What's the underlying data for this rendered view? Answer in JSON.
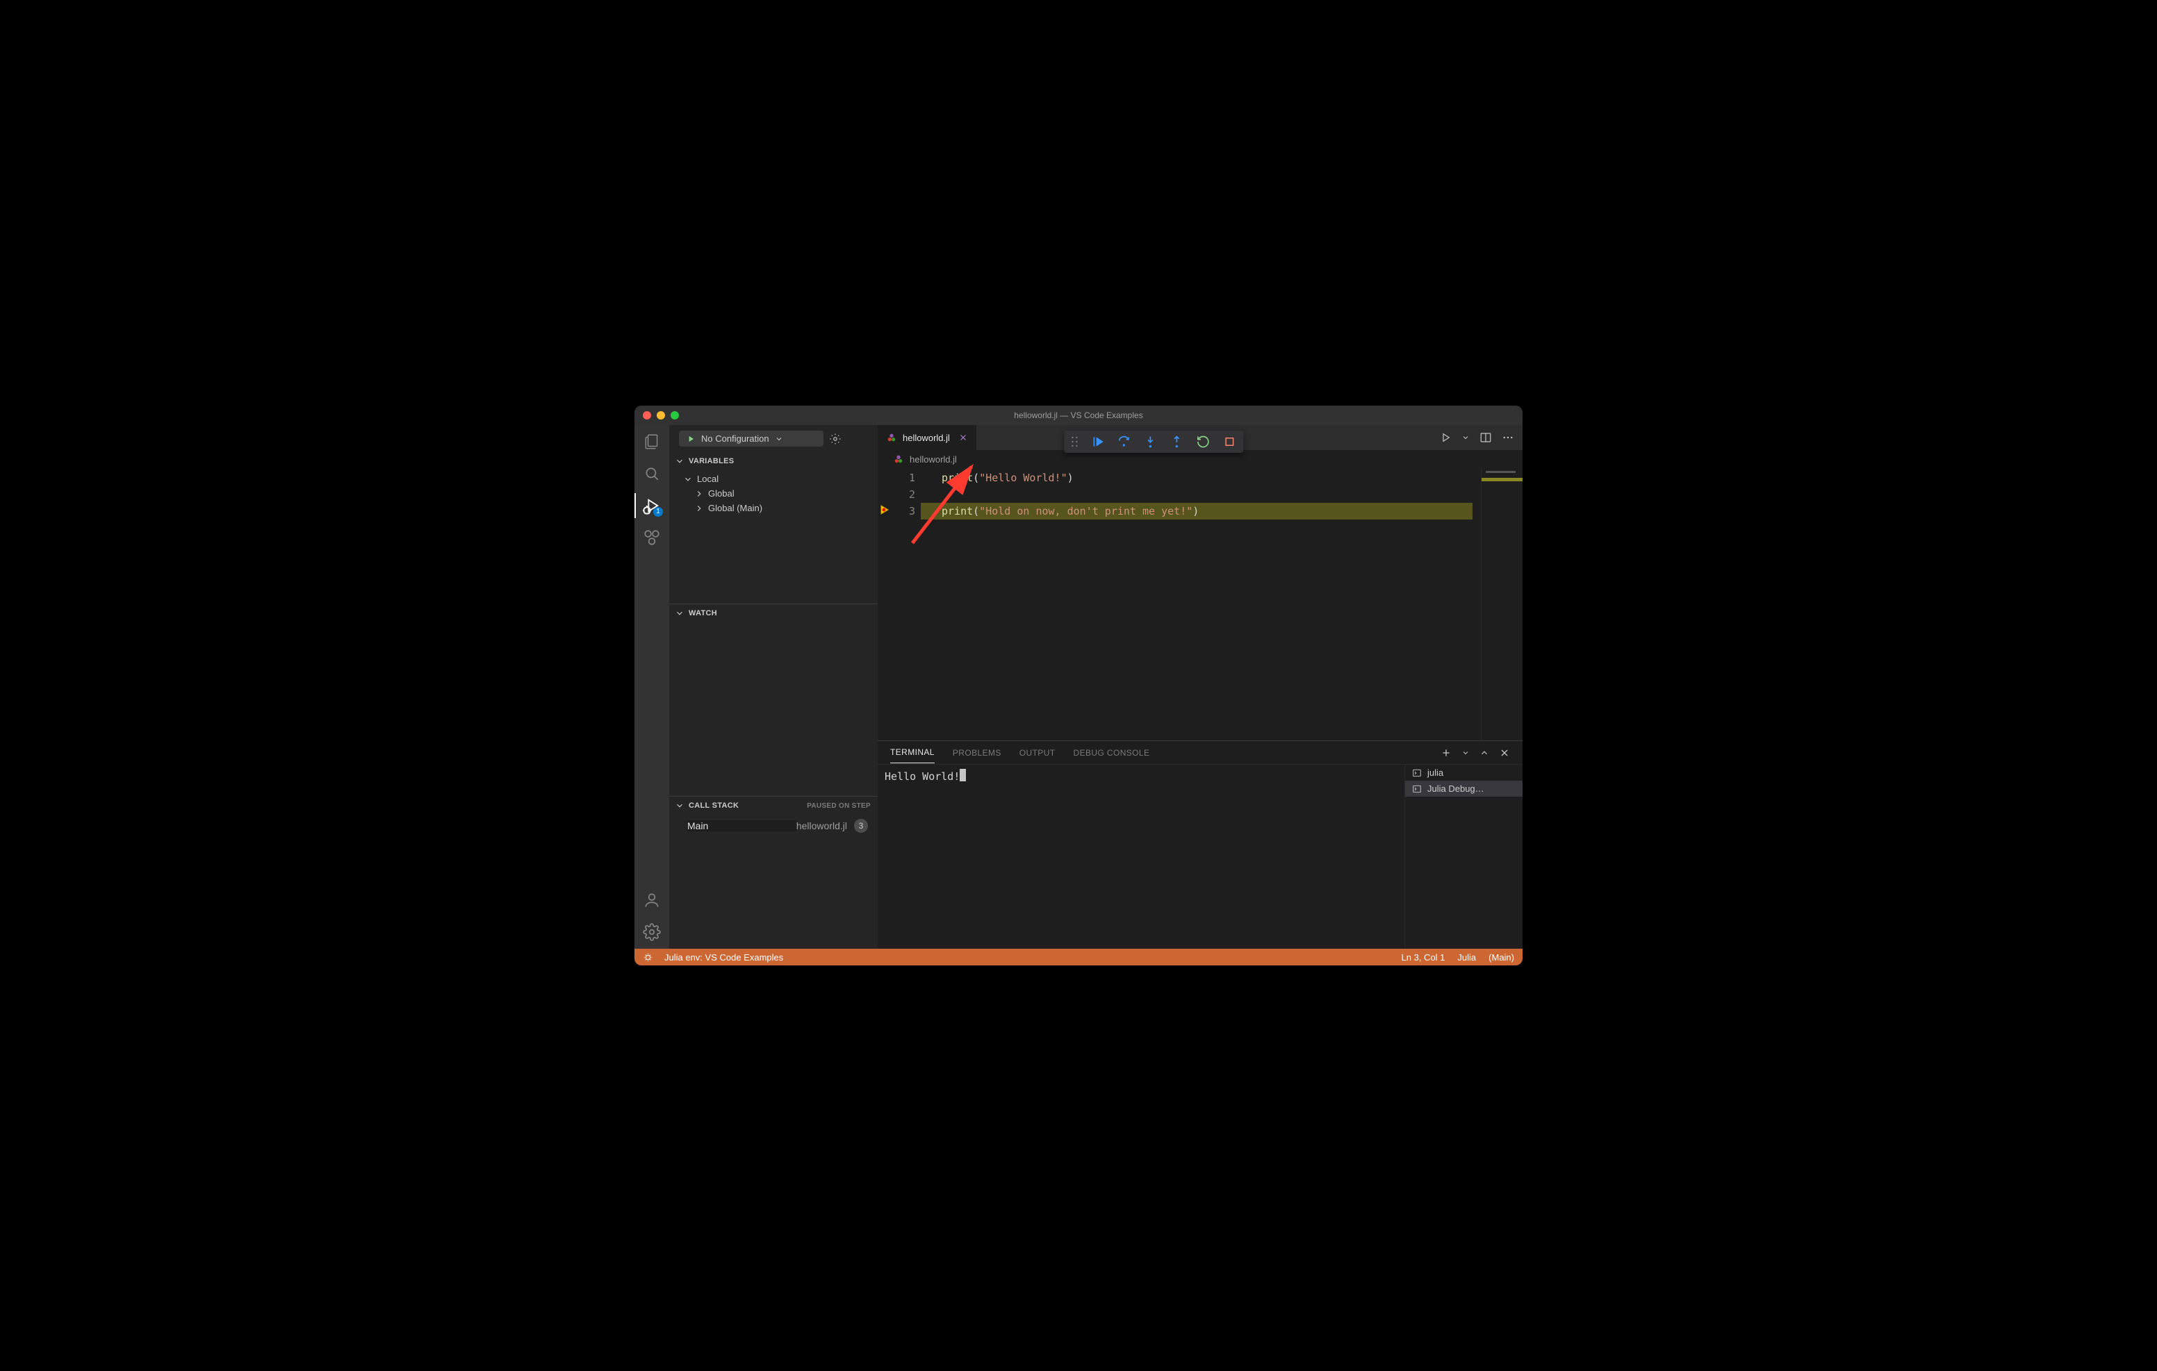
{
  "window": {
    "title": "helloworld.jl — VS Code Examples"
  },
  "activity": {
    "debug_badge": "1"
  },
  "debugConfig": {
    "label": "No Configuration"
  },
  "sidebar": {
    "variables": {
      "title": "VARIABLES",
      "items": [
        {
          "label": "Local",
          "expanded": true
        },
        {
          "label": "Global",
          "expanded": false
        },
        {
          "label": "Global (Main)",
          "expanded": false
        }
      ]
    },
    "watch": {
      "title": "WATCH"
    },
    "callstack": {
      "title": "CALL STACK",
      "status": "PAUSED ON STEP",
      "frame": {
        "name": "Main",
        "file": "helloworld.jl",
        "line": "3"
      }
    }
  },
  "tabs": {
    "active": {
      "filename": "helloworld.jl"
    }
  },
  "breadcrumb": {
    "filename": "helloworld.jl"
  },
  "editor": {
    "line_numbers": [
      "1",
      "2",
      "3"
    ],
    "code": {
      "l1": {
        "fn": "print",
        "open": "(",
        "str": "\"Hello World!\"",
        "close": ")"
      },
      "l2": "",
      "l3": {
        "fn": "print",
        "open": "(",
        "str": "\"Hold on now, don't print me yet!\"",
        "close": ")"
      }
    }
  },
  "panel": {
    "tabs": {
      "terminal": "TERMINAL",
      "problems": "PROBLEMS",
      "output": "OUTPUT",
      "debug": "DEBUG CONSOLE"
    },
    "terminal_output": "Hello World!",
    "sessions": [
      {
        "label": "julia"
      },
      {
        "label": "Julia Debug…"
      }
    ]
  },
  "statusbar": {
    "env": "Julia env: VS Code Examples",
    "pos": "Ln 3, Col 1",
    "lang": "Julia",
    "scope": "(Main)"
  }
}
